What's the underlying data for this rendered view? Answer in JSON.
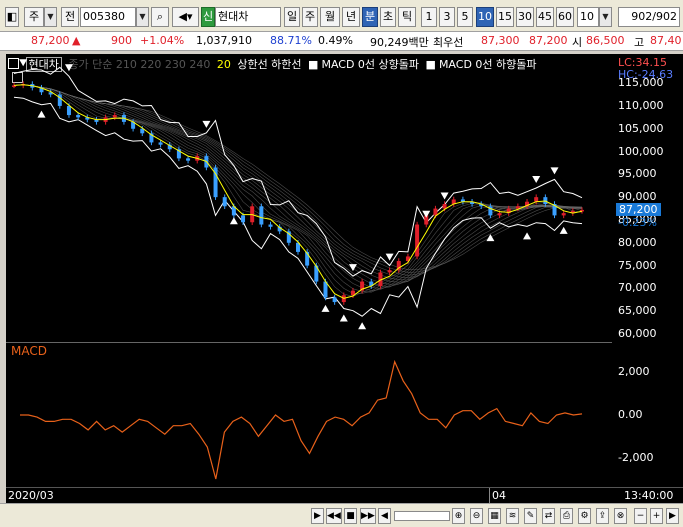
{
  "toolbar": {
    "period_select": "주",
    "prefix_select": "전",
    "stock_code": "005380",
    "sin_badge": "신",
    "stock_name": "현대차",
    "tf": [
      "일",
      "주",
      "월",
      "년",
      "분",
      "초",
      "틱"
    ],
    "tf_active": "분",
    "nums": [
      "1",
      "3",
      "5",
      "10",
      "15",
      "30",
      "45",
      "60"
    ],
    "num_active": "10",
    "count_value": "10",
    "range_value": "902",
    "range_total": "/902"
  },
  "quote": {
    "price": "87,200",
    "up_arrow": "▲",
    "change": "900",
    "change_pct": "+1.04%",
    "volume": "1,037,910",
    "vol_ratio": "88.71%",
    "turnover_pct": "0.49%",
    "amount": "90,249백만",
    "best_label": "최우선",
    "ask": "87,300",
    "bid": "87,200",
    "open_label": "시",
    "open": "86,500",
    "high_label": "고",
    "high": "87,40"
  },
  "legend": {
    "name": "현대차",
    "ma": "종가 단순 210 220 230 240",
    "ma20": "20",
    "bands": "상한선 하한선",
    "sig_up": "MACD 0선 상향돌파",
    "sig_down": "MACD 0선 하향돌파"
  },
  "yaxis": {
    "lc": "LC:34.15",
    "hc": "HC:-24.63",
    "ticks": [
      "115,000",
      "110,000",
      "105,000",
      "100,000",
      "95,000",
      "90,000",
      "85,000",
      "80,000",
      "75,000",
      "70,000",
      "65,000",
      "60,000"
    ],
    "current_price": "87,200",
    "current_pct": "-0.23%",
    "macd_ticks": [
      "2,000",
      "0.00",
      "-2,000"
    ]
  },
  "macd_label": "MACD",
  "xaxis": {
    "start": "2020/03",
    "mid": "04",
    "time": "13:40:00"
  },
  "colors": {
    "up": "#e0202a",
    "down": "#1d3fd0",
    "macd": "#e8611a",
    "ma20": "#ffff00",
    "band": "#ffffff"
  },
  "chart_data": {
    "type": "line",
    "price": {
      "ylim": [
        60000,
        117000
      ],
      "close": [
        114500,
        114800,
        114000,
        113000,
        112500,
        110000,
        108000,
        107500,
        107000,
        106500,
        107500,
        108000,
        106500,
        105000,
        104000,
        102000,
        101500,
        100500,
        98500,
        98000,
        99000,
        96500,
        90000,
        88000,
        86000,
        84500,
        88000,
        84000,
        83500,
        82500,
        80000,
        78000,
        75000,
        71500,
        68000,
        67000,
        68500,
        69500,
        71500,
        70500,
        73500,
        74000,
        76000,
        77000,
        84000,
        86000,
        87500,
        88500,
        89500,
        89000,
        88500,
        88000,
        86000,
        86500,
        87500,
        88000,
        89000,
        90000,
        88500,
        86000,
        86500,
        87000,
        87200
      ]
    },
    "macd": {
      "ylim": [
        -3000,
        3000
      ],
      "values": [
        0,
        0,
        -100,
        -300,
        -300,
        -200,
        -200,
        -400,
        -700,
        -300,
        -700,
        -500,
        -800,
        -500,
        -200,
        -300,
        -600,
        -900,
        -500,
        -500,
        -400,
        -900,
        -1500,
        -3000,
        -800,
        -300,
        -100,
        -400,
        -1000,
        -500,
        0,
        -300,
        -200,
        -1200,
        -1800,
        -1000,
        -300,
        -100,
        -200,
        -500,
        -100,
        100,
        700,
        800,
        2500,
        1600,
        1000,
        100,
        -200,
        -200,
        -600,
        0,
        200,
        200,
        -200,
        100,
        300,
        -300,
        -400,
        -500,
        100,
        -300,
        -400,
        0,
        100,
        0,
        50
      ]
    }
  }
}
